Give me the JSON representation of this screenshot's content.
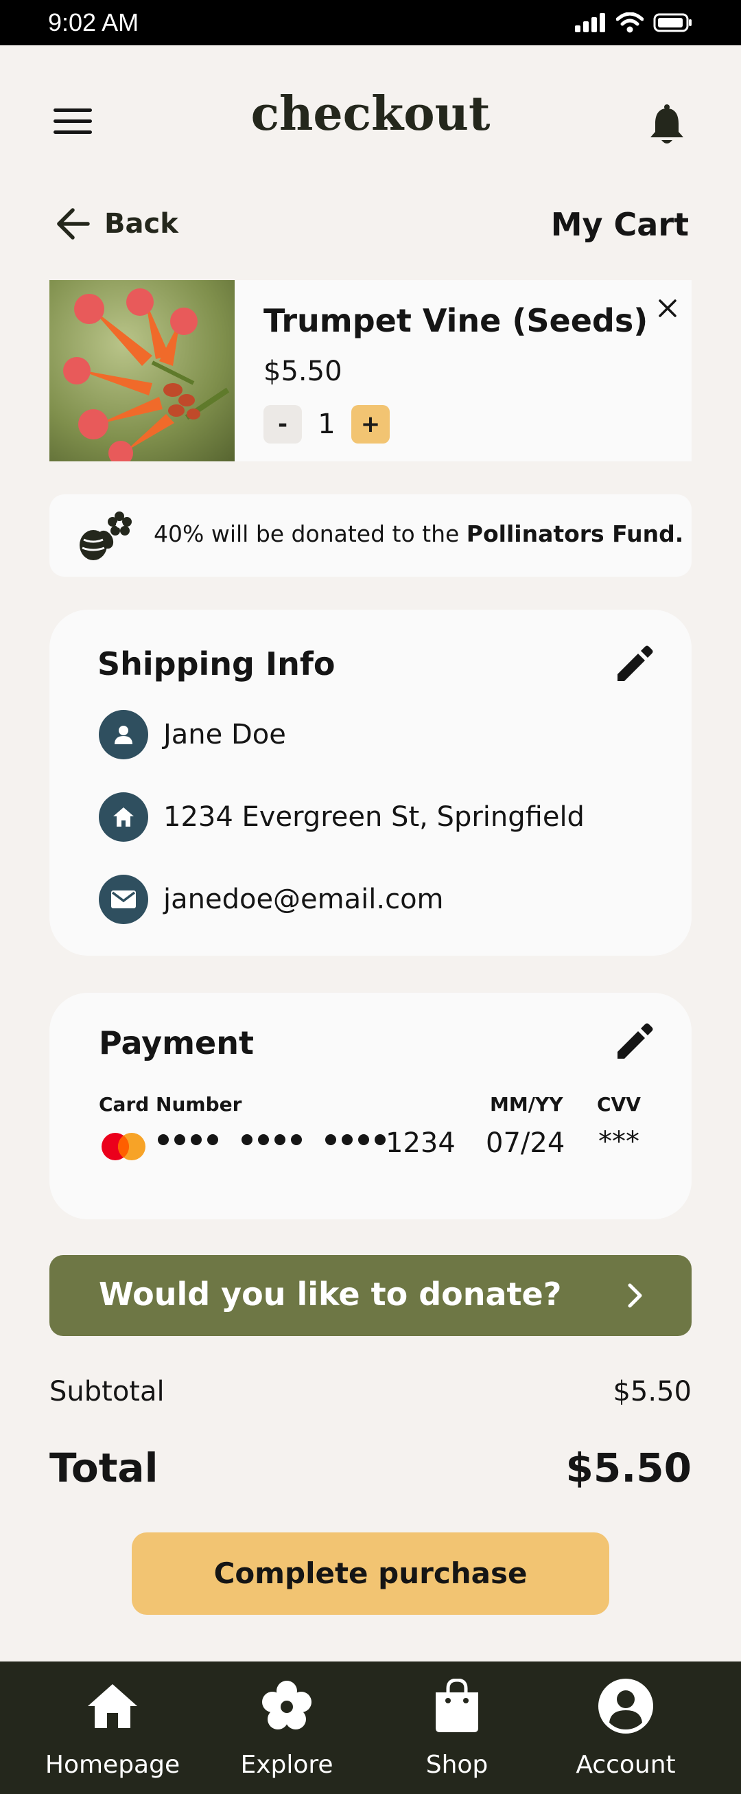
{
  "status_bar": {
    "time": "9:02 AM"
  },
  "header": {
    "title": "checkout"
  },
  "nav_row": {
    "back_label": "Back",
    "cart_title": "My Cart"
  },
  "cart_item": {
    "name": "Trumpet Vine (Seeds)",
    "price": "$5.50",
    "quantity": "1",
    "minus_label": "-",
    "plus_label": "+"
  },
  "donation_banner": {
    "text_prefix": "40% will be donated to the ",
    "text_bold": "Pollinators Fund."
  },
  "shipping": {
    "title": "Shipping Info",
    "name": "Jane Doe",
    "address": "1234 Evergreen St, Springfield",
    "email": "janedoe@email.com"
  },
  "payment": {
    "title": "Payment",
    "card_number_label": "Card Number",
    "expiry_label": "MM/YY",
    "cvv_label": "CVV",
    "card_last4": "1234",
    "expiry": "07/24",
    "cvv": "***"
  },
  "donate_button": {
    "label": "Would you like to donate?"
  },
  "summary": {
    "subtotal_label": "Subtotal",
    "subtotal_value": "$5.50",
    "total_label": "Total",
    "total_value": "$5.50"
  },
  "purchase_button": {
    "label": "Complete purchase"
  },
  "bottom_nav": {
    "items": [
      {
        "label": "Homepage",
        "icon": "home-icon"
      },
      {
        "label": "Explore",
        "icon": "flower-icon"
      },
      {
        "label": "Shop",
        "icon": "shopping-bag-icon"
      },
      {
        "label": "Account",
        "icon": "account-icon"
      }
    ]
  },
  "colors": {
    "background": "#f5f2ef",
    "dark": "#24271c",
    "accent_yellow": "#f2c472",
    "olive": "#6e7745",
    "badge": "#2f4f5f"
  }
}
